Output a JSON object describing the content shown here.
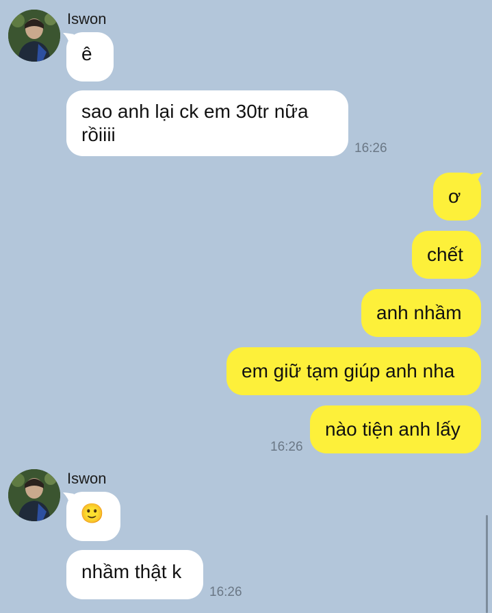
{
  "colors": {
    "background": "#b3c6da",
    "incoming_bubble": "#ffffff",
    "outgoing_bubble": "#fdf03a",
    "timestamp": "#6a7785"
  },
  "groups": [
    {
      "sender": "Iswon",
      "avatar_icon": "user-avatar-icon",
      "messages": [
        "ê",
        "sao anh lại ck em 30tr nữa rồiiii"
      ],
      "time": "16:26"
    },
    {
      "sender": "me",
      "messages": [
        "ơ",
        "chết",
        "anh nhầm",
        "em giữ tạm giúp anh nha",
        "nào tiện anh lấy"
      ],
      "time": "16:26"
    },
    {
      "sender": "Iswon",
      "avatar_icon": "user-avatar-icon",
      "messages": [
        "🙂",
        "nhầm thật k"
      ],
      "time": "16:26"
    }
  ]
}
